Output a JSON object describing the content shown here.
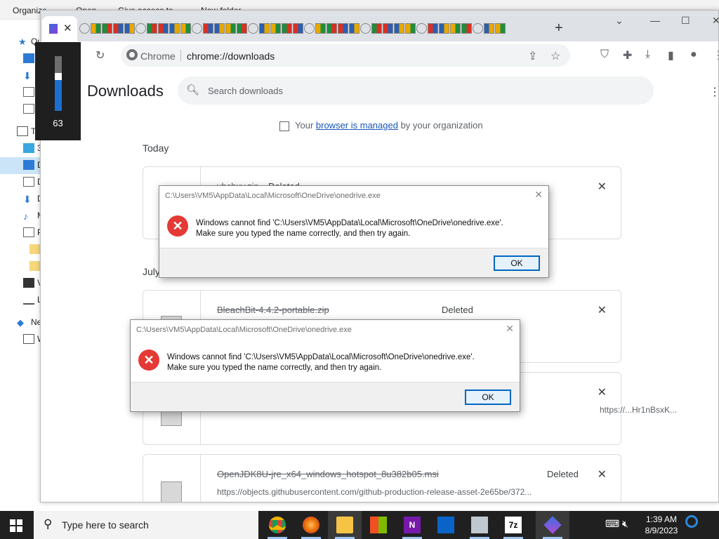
{
  "explorer": {
    "toolbar": [
      "Organize",
      "Open",
      "Give access to",
      "New folder"
    ],
    "nav_items": [
      "Qu",
      "Th",
      "3",
      "D",
      "D",
      "D",
      "M",
      "P",
      "V",
      "L",
      "Ne",
      "W"
    ]
  },
  "volume_osd": {
    "value": "63",
    "level": 0.63
  },
  "chrome": {
    "tab_close": "✕",
    "new_tab": "+",
    "omnibox": {
      "scheme_label": "Chrome",
      "url": "chrome://downloads"
    },
    "page_title": "Downloads",
    "search_placeholder": "Search downloads",
    "managed": {
      "prefix": "Your ",
      "link": "browser is managed",
      "suffix": " by your organization"
    },
    "groups": [
      "Today",
      "July"
    ],
    "downloads": [
      {
        "name": "vbcbxv.zip",
        "status": "Deleted",
        "url": ""
      },
      {
        "name": "BleachBit-4.4.2-portable.zip",
        "status": "Deleted",
        "url": ""
      },
      {
        "name": "",
        "status": "",
        "url": "https://...Hr1nBsxK..."
      },
      {
        "name": "OpenJDK8U-jre_x64_windows_hotspot_8u382b05.msi",
        "status": "Deleted",
        "url": "https://objects.githubusercontent.com/github-production-release-asset-2e65be/372..."
      }
    ]
  },
  "dialogs": [
    {
      "title": "C:\\Users\\VM5\\AppData\\Local\\Microsoft\\OneDrive\\onedrive.exe",
      "line1": "Windows cannot find 'C:\\Users\\VM5\\AppData\\Local\\Microsoft\\OneDrive\\onedrive.exe'.",
      "line2": "Make sure you typed the name correctly, and then try again.",
      "ok": "OK"
    },
    {
      "title": "C:\\Users\\VM5\\AppData\\Local\\Microsoft\\OneDrive\\onedrive.exe",
      "line1": "Windows cannot find 'C:\\Users\\VM5\\AppData\\Local\\Microsoft\\OneDrive\\onedrive.exe'.",
      "line2": "Make sure you typed the name correctly, and then try again.",
      "ok": "OK"
    }
  ],
  "taskbar": {
    "search_placeholder": "Type here to search",
    "apps": [
      "chrome",
      "firefox",
      "file-explorer",
      "store",
      "onenote",
      "mail",
      "task-manager",
      "7zip",
      "app"
    ],
    "time": "1:39 AM",
    "date": "8/9/2023"
  }
}
